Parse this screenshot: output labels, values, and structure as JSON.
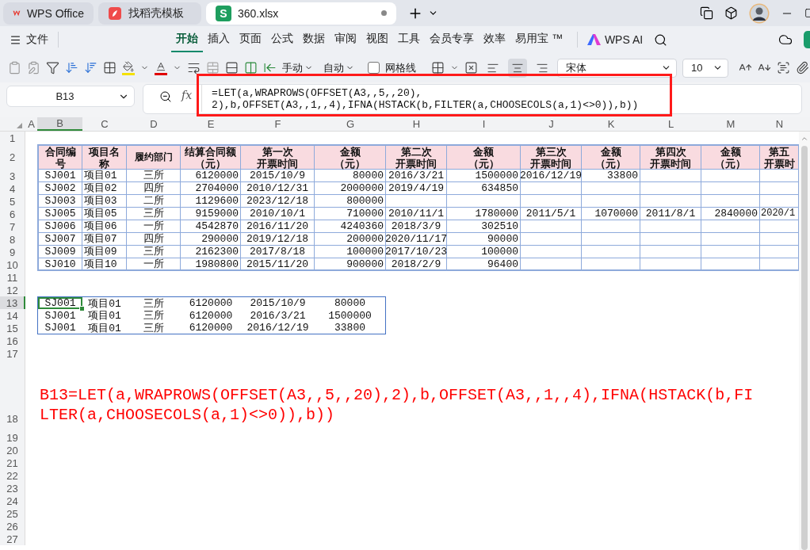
{
  "tabs": [
    {
      "label": "WPS Office",
      "kind": "wps",
      "selected": false,
      "modified": false
    },
    {
      "label": "找稻壳模板",
      "kind": "docer",
      "selected": false,
      "modified": false
    },
    {
      "label": "360.xlsx",
      "kind": "sheet",
      "badge": "S",
      "selected": true,
      "modified": true
    }
  ],
  "menu": {
    "file": "文件",
    "items": [
      {
        "label": "开始",
        "selected": true
      },
      {
        "label": "插入",
        "selected": false
      },
      {
        "label": "页面",
        "selected": false
      },
      {
        "label": "公式",
        "selected": false
      },
      {
        "label": "数据",
        "selected": false
      },
      {
        "label": "审阅",
        "selected": false
      },
      {
        "label": "视图",
        "selected": false
      },
      {
        "label": "工具",
        "selected": false
      },
      {
        "label": "会员专享",
        "selected": false
      },
      {
        "label": "效率",
        "selected": false
      },
      {
        "label": "易用宝 ™",
        "selected": false
      }
    ],
    "ai": "WPS AI"
  },
  "toolbar": {
    "row_height": "手动",
    "col_width": "自动",
    "gridlines": {
      "label": "网格线",
      "checked": false
    },
    "alignment": [
      {
        "kind": "left",
        "selected": false
      },
      {
        "kind": "center",
        "selected": true
      },
      {
        "kind": "right",
        "selected": false
      }
    ],
    "font": "宋体",
    "size": "10"
  },
  "formula_bar": {
    "name_box": "B13",
    "fx": "fx",
    "formula": "=LET(a,WRAPROWS(OFFSET(A3,,5,,20),\n2),b,OFFSET(A3,,1,,4),IFNA(HSTACK(b,FILTER(a,CHOOSECOLS(a,1)<>0)),b))"
  },
  "sheet": {
    "columns": [
      {
        "letter": "A",
        "selected": false
      },
      {
        "letter": "B",
        "selected": true
      },
      {
        "letter": "C",
        "selected": false
      },
      {
        "letter": "D",
        "selected": false
      },
      {
        "letter": "E",
        "selected": false
      },
      {
        "letter": "F",
        "selected": false
      },
      {
        "letter": "G",
        "selected": false
      },
      {
        "letter": "H",
        "selected": false
      },
      {
        "letter": "I",
        "selected": false
      },
      {
        "letter": "J",
        "selected": false
      },
      {
        "letter": "K",
        "selected": false
      },
      {
        "letter": "L",
        "selected": false
      },
      {
        "letter": "M",
        "selected": false
      },
      {
        "letter": "N",
        "selected": false
      }
    ],
    "rows": [
      {
        "number": "1",
        "selected": false,
        "kind": "blank"
      },
      {
        "number": "2",
        "selected": false,
        "kind": "table-header",
        "cells": [
          {
            "lines": [
              "合同编",
              "号"
            ]
          },
          {
            "lines": [
              "项目名",
              "称"
            ]
          },
          {
            "lines": [
              "履约部门"
            ]
          },
          {
            "lines": [
              "结算合同额",
              "（元）"
            ]
          },
          {
            "lines": [
              "第一次",
              "开票时间"
            ]
          },
          {
            "lines": [
              "金额",
              "（元）"
            ]
          },
          {
            "lines": [
              "第二次",
              "开票时间"
            ]
          },
          {
            "lines": [
              "金额",
              "（元）"
            ]
          },
          {
            "lines": [
              "第三次",
              "开票时间"
            ]
          },
          {
            "lines": [
              "金额",
              "（元）"
            ]
          },
          {
            "lines": [
              "第四次",
              "开票时间"
            ]
          },
          {
            "lines": [
              "金额",
              "（元）"
            ]
          },
          {
            "lines": [
              "第五",
              "开票时"
            ]
          }
        ]
      },
      {
        "number": "3",
        "selected": false,
        "kind": "table-row",
        "cells": [
          "SJ001",
          "项目01",
          "三所",
          "6120000",
          "2015/10/9",
          "80000",
          "2016/3/21",
          "1500000",
          "2016/12/19",
          "33800"
        ]
      },
      {
        "number": "4",
        "selected": false,
        "kind": "table-row",
        "cells": [
          "SJ002",
          "项目02",
          "四所",
          "2704000",
          "2010/12/31",
          "2000000",
          "2019/4/19",
          "634850"
        ]
      },
      {
        "number": "5",
        "selected": false,
        "kind": "table-row",
        "cells": [
          "SJ003",
          "项目03",
          "二所",
          "1129600",
          "2023/12/18",
          "800000"
        ]
      },
      {
        "number": "6",
        "selected": false,
        "kind": "table-row",
        "cells": [
          "SJ005",
          "项目05",
          "三所",
          "9159000",
          "2010/10/1",
          "710000",
          "2010/11/1",
          "1780000",
          "2011/5/1",
          "1070000",
          "2011/8/1",
          "2840000",
          "2020/1"
        ]
      },
      {
        "number": "7",
        "selected": false,
        "kind": "table-row",
        "cells": [
          "SJ006",
          "项目06",
          "一所",
          "4542870",
          "2016/11/20",
          "4240360",
          "2018/3/9",
          "302510"
        ]
      },
      {
        "number": "8",
        "selected": false,
        "kind": "table-row",
        "cells": [
          "SJ007",
          "项目07",
          "四所",
          "290000",
          "2019/12/18",
          "200000",
          "2020/11/17",
          "90000"
        ]
      },
      {
        "number": "9",
        "selected": false,
        "kind": "table-row",
        "cells": [
          "SJ009",
          "项目09",
          "三所",
          "2162300",
          "2017/8/18",
          "100000",
          "2017/10/23",
          "100000"
        ]
      },
      {
        "number": "10",
        "selected": false,
        "kind": "table-row",
        "cells": [
          "SJ010",
          "项目10",
          "一所",
          "1980800",
          "2015/11/20",
          "900000",
          "2018/2/9",
          "96400"
        ]
      },
      {
        "number": "11",
        "selected": false,
        "kind": "blank"
      },
      {
        "number": "12",
        "selected": false,
        "kind": "blank"
      },
      {
        "number": "13",
        "selected": true,
        "kind": "result-row",
        "cells": [
          "SJ001",
          "项目01",
          "三所",
          "6120000",
          "2015/10/9",
          "80000"
        ]
      },
      {
        "number": "14",
        "selected": false,
        "kind": "result-row",
        "cells": [
          "SJ001",
          "项目01",
          "三所",
          "6120000",
          "2016/3/21",
          "1500000"
        ]
      },
      {
        "number": "15",
        "selected": false,
        "kind": "result-row",
        "cells": [
          "SJ001",
          "项目01",
          "三所",
          "6120000",
          "2016/12/19",
          "33800"
        ]
      },
      {
        "number": "16",
        "selected": false,
        "kind": "blank"
      },
      {
        "number": "17",
        "selected": false,
        "kind": "blank"
      },
      {
        "number": "18",
        "selected": false,
        "kind": "note",
        "text": "B13=LET(a,WRAPROWS(OFFSET(A3,,5,,20),2),b,OFFSET(A3,,1,,4),IFNA(HSTACK(b,FI\nLTER(a,CHOOSECOLS(a,1)<>0)),b))"
      },
      {
        "number": "19",
        "selected": false,
        "kind": "blank"
      },
      {
        "number": "20",
        "selected": false,
        "kind": "blank"
      },
      {
        "number": "21",
        "selected": false,
        "kind": "blank"
      },
      {
        "number": "22",
        "selected": false,
        "kind": "blank"
      },
      {
        "number": "23",
        "selected": false,
        "kind": "blank"
      },
      {
        "number": "24",
        "selected": false,
        "kind": "blank"
      },
      {
        "number": "25",
        "selected": false,
        "kind": "blank"
      },
      {
        "number": "26",
        "selected": false,
        "kind": "blank"
      },
      {
        "number": "27",
        "selected": false,
        "kind": "blank"
      }
    ]
  }
}
